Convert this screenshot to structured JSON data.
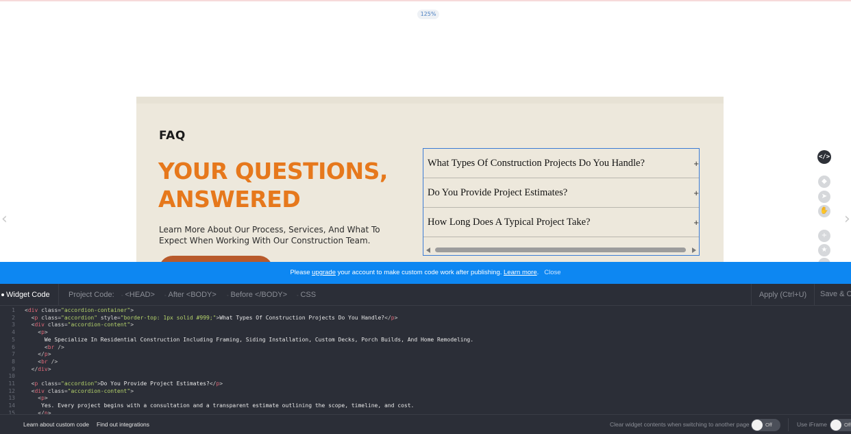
{
  "zoom_level": "125%",
  "faq": {
    "eyebrow": "FAQ",
    "heading_line1": "YOUR QUESTIONS,",
    "heading_line2": "ANSWERED",
    "description": "Learn More About Our Process, Services, And What To Expect When Working With Our Construction Team.",
    "accordion": [
      {
        "question": "What Types Of Construction Projects Do You Handle?",
        "icon": "+"
      },
      {
        "question": "Do You Provide Project Estimates?",
        "icon": "+"
      },
      {
        "question": "How Long Does A Typical Project Take?",
        "icon": "+"
      }
    ]
  },
  "tools": {
    "code_label": "</>"
  },
  "banner": {
    "text_before": "Please ",
    "upgrade_link": "upgrade",
    "text_after": " your account to make custom code work after publishing. ",
    "learn_more": "Learn more",
    "dot": ".",
    "close": "Close"
  },
  "tabs": {
    "widget_code": "Widget Code",
    "project_code": "Project Code:",
    "head": "<HEAD>",
    "after_body": "After <BODY>",
    "before_body": "Before </BODY>",
    "css": "CSS",
    "apply": "Apply (Ctrl+U)",
    "save": "Save & Cl"
  },
  "code_lines": [
    {
      "n": "1",
      "text": "<div class=\"accordion-container\">"
    },
    {
      "n": "2",
      "text": "  <p class=\"accordion\" style=\"border-top: 1px solid #999;\">What Types Of Construction Projects Do You Handle?</p>"
    },
    {
      "n": "3",
      "text": "  <div class=\"accordion-content\">"
    },
    {
      "n": "4",
      "text": "    <p>"
    },
    {
      "n": "5",
      "text": "      We Specialize In Residential Construction Including Framing, Siding Installation, Custom Decks, Porch Builds, And Home Remodeling."
    },
    {
      "n": "6",
      "text": "      <br />"
    },
    {
      "n": "7",
      "text": "    </p>"
    },
    {
      "n": "8",
      "text": "    <br />"
    },
    {
      "n": "9",
      "text": "  </div>"
    },
    {
      "n": "10",
      "text": ""
    },
    {
      "n": "11",
      "text": "  <p class=\"accordion\">Do You Provide Project Estimates?</p>"
    },
    {
      "n": "12",
      "text": "  <div class=\"accordion-content\">"
    },
    {
      "n": "13",
      "text": "    <p>"
    },
    {
      "n": "14",
      "text": "     Yes. Every project begins with a consultation and a transparent estimate outlining the scope, timeline, and cost."
    },
    {
      "n": "15",
      "text": "    </p>"
    }
  ],
  "footer": {
    "learn_custom_code": "Learn about custom code",
    "find_integrations": "Find out integrations",
    "clear_contents": "Clear widget contents when switching to another page",
    "toggle1": "Off",
    "use_iframe": "Use iFrame",
    "toggle2": "Off"
  },
  "colors": {
    "accent_orange": "#e6781c",
    "banner_blue": "#0d87f2",
    "panel_bg": "#2b2e37",
    "section_bg": "#ede8dc"
  }
}
